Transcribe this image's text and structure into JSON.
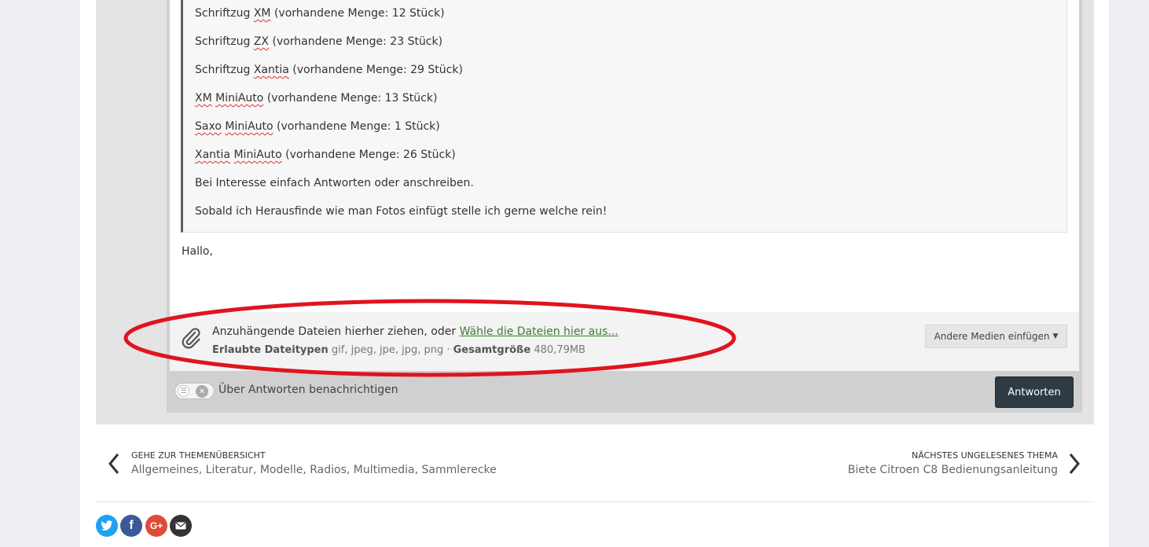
{
  "quote": {
    "lines": [
      {
        "pre": "Schriftzug ",
        "mark": "XM",
        "post": " (vorhandene Menge: 12 Stück)"
      },
      {
        "pre": "Schriftzug ",
        "mark": "ZX",
        "post": " (vorhandene Menge: 23 Stück)"
      },
      {
        "pre": "Schriftzug ",
        "mark": "Xantia",
        "post": " (vorhandene Menge: 29 Stück)"
      },
      {
        "pre": "",
        "mark": "XM",
        "mid": " ",
        "mark2": "MiniAuto",
        "post": " (vorhandene Menge: 13 Stück)"
      },
      {
        "pre": "",
        "mark": "Saxo",
        "mid": " ",
        "mark2": "MiniAuto",
        "post": " (vorhandene Menge: 1 Stück)"
      },
      {
        "pre": "",
        "mark": "Xantia",
        "mid": " ",
        "mark2": "MiniAuto",
        "post": " (vorhandene Menge: 26 Stück)"
      },
      {
        "pre": "Bei Interesse einfach Antworten oder anschreiben."
      },
      {
        "pre": "Sobald ich Herausfinde wie man Fotos einfügt stelle ich gerne welche rein!"
      }
    ]
  },
  "editor": {
    "text": "Hallo,"
  },
  "attachments": {
    "prompt": "Anzuhängende Dateien hierher ziehen, oder ",
    "link": "Wähle die Dateien hier aus...",
    "types_label": "Erlaubte Dateitypen",
    "types": " gif, jpeg, jpe, jpg, png · ",
    "size_label": "Gesamtgröße",
    "size": " 480,79MB",
    "clip_icon": "paperclip-icon",
    "media_button": "Andere Medien einfügen"
  },
  "footer_bar": {
    "toggle_label": "Über Antworten benachrichtigen",
    "submit": "Antworten"
  },
  "annotation": {
    "color": "#e0141e"
  },
  "navigation": {
    "prev_caption": "Gehe zur Themenübersicht",
    "prev_title": "Allgemeines, Literatur, Modelle, Radios, Multimedia, Sammlerecke",
    "next_caption": "Nächstes ungelesenes Thema",
    "next_title": "Biete Citroen C8 Bedienungsanleitung"
  },
  "share": [
    {
      "name": "twitter",
      "icon": "twitter-icon",
      "color": "#1da1f2"
    },
    {
      "name": "facebook",
      "icon": "facebook-icon",
      "color": "#3b5998"
    },
    {
      "name": "google-plus",
      "icon": "google-plus-icon",
      "color": "#dd4b39"
    },
    {
      "name": "email",
      "icon": "mail-icon",
      "color": "#333333"
    }
  ]
}
